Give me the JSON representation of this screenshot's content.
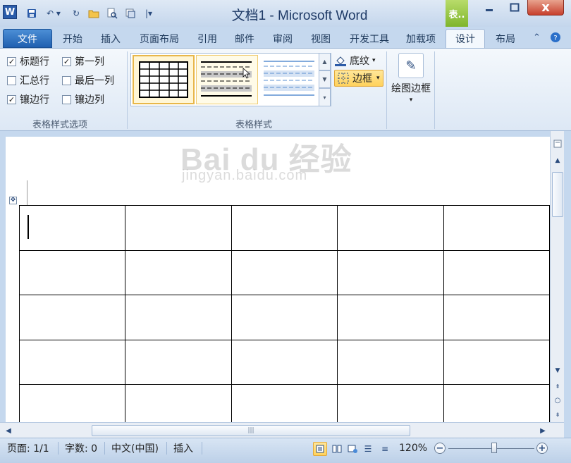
{
  "title_bar": {
    "app_icon": "W",
    "title": "文档1  -  Microsoft Word",
    "context_tab": "表..",
    "minimize": "—",
    "maximize": "□",
    "close": "x"
  },
  "tabs": [
    "文件",
    "开始",
    "插入",
    "页面布局",
    "引用",
    "邮件",
    "审阅",
    "视图",
    "开发工具",
    "加载项",
    "设计",
    "布局"
  ],
  "active_tab": "设计",
  "ribbon": {
    "table_style_options": {
      "label": "表格样式选项",
      "checkboxes": [
        {
          "label": "标题行",
          "checked": true
        },
        {
          "label": "第一列",
          "checked": true
        },
        {
          "label": "汇总行",
          "checked": false
        },
        {
          "label": "最后一列",
          "checked": false
        },
        {
          "label": "镶边行",
          "checked": true
        },
        {
          "label": "镶边列",
          "checked": false
        }
      ]
    },
    "table_styles": {
      "label": "表格样式",
      "shading": "底纹",
      "borders": "边框"
    },
    "draw_borders": {
      "label": "绘图边框"
    }
  },
  "watermark": {
    "main": "Bai du 经验",
    "sub": "jingyan.baidu.com"
  },
  "table": {
    "rows": 5,
    "cols": 5
  },
  "status_bar": {
    "page": "页面: 1/1",
    "word_count": "字数: 0",
    "language": "中文(中国)",
    "mode": "插入",
    "zoom": "120%"
  },
  "colors": {
    "accent": "#2a5caa",
    "ribbon_bg": "#dde8f5",
    "highlight": "#ffd25c",
    "context_tab": "#7fb52c"
  }
}
